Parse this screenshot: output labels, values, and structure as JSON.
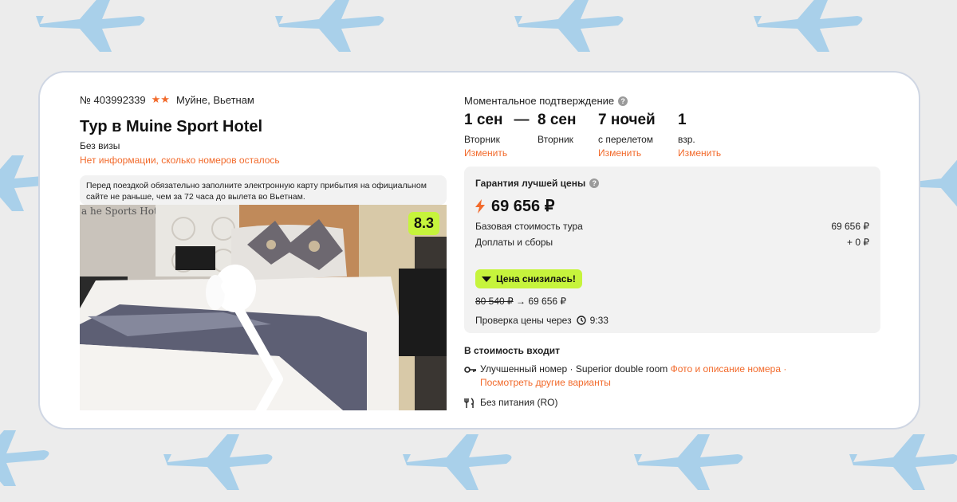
{
  "colors": {
    "accent": "#f26a2b",
    "lime": "#c6f43c",
    "card_border": "#cfd6e3",
    "plane": "#a9d0ea",
    "page_bg": "#ececec"
  },
  "header": {
    "tour_number": "№ 403992339",
    "stars": "★★",
    "location": "Муйне, Вьетнам",
    "title": "Тур в Muine Sport Hotel",
    "visa": "Без визы",
    "rooms_info": "Нет информации, сколько номеров осталось"
  },
  "notice": "Перед поездкой обязательно заполните электронную карту прибытия на официальном сайте не раньше, чем за 72 часа до вылета во Вьетнам.",
  "photo": {
    "rating": "8.3",
    "alt": "Hotel room with bed and towel swans",
    "sign_text": "a he Sports Hotel"
  },
  "booking": {
    "confirmation": "Моментальное подтверждение",
    "date_from": "1 сен",
    "dash": "—",
    "date_to": "8 сен",
    "from_day": "Вторник",
    "to_day": "Вторник",
    "change": "Изменить",
    "nights": "7 ночей",
    "nights_note": "с перелетом",
    "adults": "1",
    "adults_note": "взр."
  },
  "price": {
    "guarantee": "Гарантия лучшей цены",
    "total": "69 656 ₽",
    "base_label": "Базовая стоимость тура",
    "base_value": "69 656 ₽",
    "extra_label": "Доплаты и сборы",
    "extra_value": "+ 0 ₽",
    "drop_badge": "Цена снизилась!",
    "old_price": "80 540 ₽",
    "arrow": "→",
    "new_price": "69 656 ₽",
    "check_label": "Проверка цены через",
    "check_time": "9:33"
  },
  "included": {
    "title": "В стоимость входит",
    "room": "Улучшенный номер · Superior double room ",
    "photo_link": "Фото и описание номера ·",
    "other_link": "Посмотреть другие варианты",
    "meal": "Без питания (RO)"
  },
  "icons": [
    "question-icon",
    "bolt-icon",
    "triangle-down-icon",
    "clock-icon",
    "key-icon",
    "fork-knife-icon",
    "chevron-right-icon",
    "plane-icon"
  ]
}
